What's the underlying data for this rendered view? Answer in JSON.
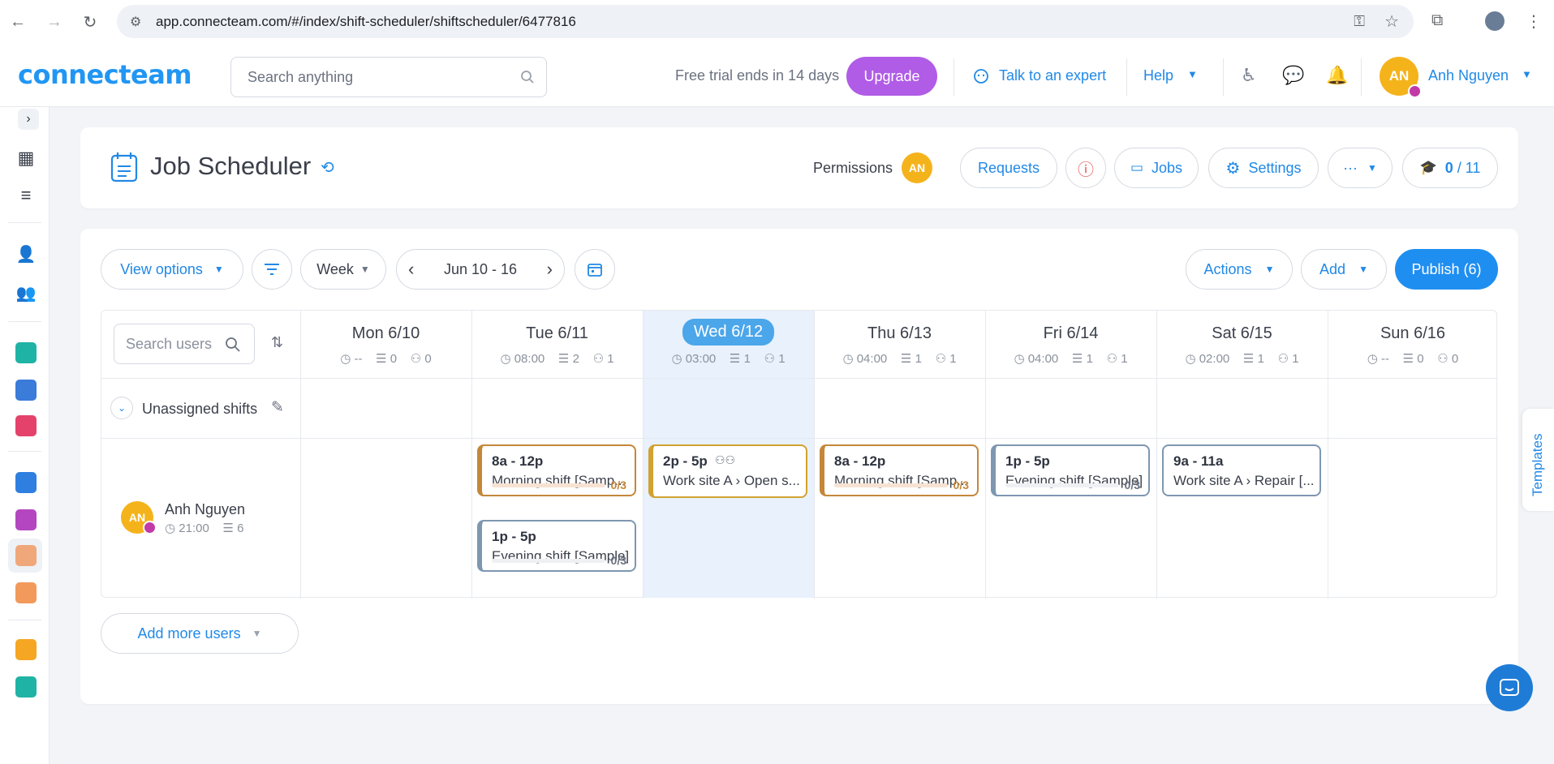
{
  "browser": {
    "url": "app.connecteam.com/#/index/shift-scheduler/shiftscheduler/6477816"
  },
  "header": {
    "logo": "connecteam",
    "search_placeholder": "Search anything",
    "trial_text": "Free trial ends in 14 days",
    "upgrade_label": "Upgrade",
    "expert_label": "Talk to an expert",
    "help_label": "Help",
    "user_initials": "AN",
    "user_name": "Anh Nguyen"
  },
  "page": {
    "title": "Job Scheduler",
    "permissions_label": "Permissions",
    "permissions_initials": "AN",
    "requests_label": "Requests",
    "jobs_label": "Jobs",
    "settings_label": "Settings",
    "more_label": "···",
    "onboarding_done": "0",
    "onboarding_total": "/ 11"
  },
  "toolbar": {
    "view_options_label": "View options",
    "period_label": "Week",
    "date_range": "Jun 10 - 16",
    "actions_label": "Actions",
    "add_label": "Add",
    "publish_label": "Publish (6)"
  },
  "grid": {
    "search_users_placeholder": "Search users",
    "unassigned_label": "Unassigned shifts",
    "days": [
      {
        "label": "Mon 6/10",
        "hours": "--",
        "shifts": "0",
        "users": "0"
      },
      {
        "label": "Tue 6/11",
        "hours": "08:00",
        "shifts": "2",
        "users": "1"
      },
      {
        "label": "Wed 6/12",
        "hours": "03:00",
        "shifts": "1",
        "users": "1"
      },
      {
        "label": "Thu 6/13",
        "hours": "04:00",
        "shifts": "1",
        "users": "1"
      },
      {
        "label": "Fri 6/14",
        "hours": "04:00",
        "shifts": "1",
        "users": "1"
      },
      {
        "label": "Sat 6/15",
        "hours": "02:00",
        "shifts": "1",
        "users": "1"
      },
      {
        "label": "Sun 6/16",
        "hours": "--",
        "shifts": "0",
        "users": "0"
      }
    ],
    "user": {
      "initials": "AN",
      "name": "Anh Nguyen",
      "hours": "21:00",
      "shifts": "6"
    },
    "shifts": [
      {
        "time": "8a - 12p",
        "name": "Morning shift [Samp...",
        "count": "0/3"
      },
      {
        "time": "1p - 5p",
        "name": "Evening shift [Sample]",
        "count": "0/3"
      },
      {
        "time": "2p - 5p",
        "name": "Work site A › Open s..."
      },
      {
        "time": "8a - 12p",
        "name": "Morning shift [Samp...",
        "count": "0/3"
      },
      {
        "time": "1p - 5p",
        "name": "Evening shift [Sample]",
        "count": "0/3"
      },
      {
        "time": "9a - 11a",
        "name": "Work site A › Repair [..."
      }
    ],
    "add_more_users_label": "Add more users"
  },
  "side_tab": "Templates",
  "colors": {
    "accent": "#2189e6",
    "publish": "#1f8ef1",
    "upgrade": "#b05ce6",
    "today_bg": "#e8f1fc",
    "avatar": "#f5b31b"
  }
}
